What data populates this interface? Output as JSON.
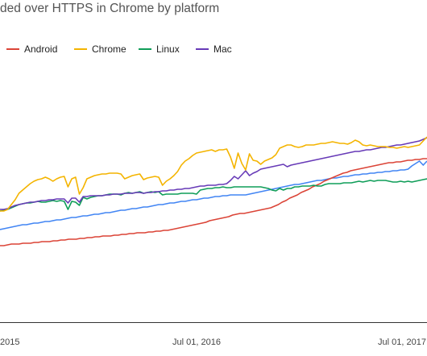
{
  "chart_data": {
    "type": "line",
    "title": "ded over HTTPS in Chrome by platform",
    "xlabel": "",
    "ylabel": "",
    "legend_position": "top-left",
    "grid": false,
    "x_tick_labels": [
      "2015",
      "Jul 01, 2016",
      "Jul 01, 2017"
    ],
    "series": [
      {
        "name": "Android",
        "color": "#db4437",
        "values": [
          305,
          305,
          304,
          303,
          303,
          303,
          302,
          302,
          302,
          301,
          301,
          300,
          300,
          300,
          299,
          299,
          298,
          298,
          297,
          297,
          297,
          296,
          296,
          295,
          295,
          294,
          294,
          293,
          293,
          293,
          292,
          292,
          291,
          291,
          290,
          290,
          289,
          289,
          289,
          288,
          288,
          287,
          287,
          286,
          286,
          285,
          284,
          283,
          282,
          281,
          280,
          279,
          278,
          277,
          276,
          274,
          273,
          272,
          271,
          270,
          269,
          267,
          266,
          265,
          265,
          264,
          263,
          262,
          261,
          260,
          259,
          258,
          256,
          254,
          251,
          249,
          246,
          244,
          242,
          239,
          237,
          235,
          232,
          230,
          228,
          225,
          223,
          221,
          219,
          217,
          215,
          214,
          212,
          211,
          210,
          209,
          208,
          207,
          206,
          205,
          204,
          203,
          202,
          202,
          201,
          201,
          200,
          199,
          199,
          198,
          198,
          197,
          197
        ]
      },
      {
        "name": "Chrome",
        "color": "#f4b400",
        "values": [
          262,
          262,
          260,
          254,
          248,
          240,
          236,
          232,
          228,
          225,
          223,
          222,
          220,
          222,
          225,
          222,
          220,
          219,
          232,
          222,
          220,
          241,
          233,
          222,
          220,
          218,
          217,
          216,
          216,
          215,
          215,
          215,
          216,
          222,
          220,
          218,
          217,
          216,
          223,
          221,
          220,
          219,
          220,
          230,
          225,
          222,
          218,
          213,
          205,
          200,
          197,
          193,
          190,
          189,
          188,
          187,
          186,
          188,
          186,
          186,
          185,
          195,
          209,
          190,
          203,
          211,
          191,
          199,
          200,
          204,
          200,
          198,
          196,
          192,
          184,
          182,
          180,
          180,
          182,
          183,
          182,
          180,
          180,
          180,
          179,
          178,
          178,
          177,
          176,
          177,
          178,
          178,
          179,
          177,
          174,
          176,
          180,
          181,
          180,
          181,
          182,
          182,
          182,
          183,
          183,
          184,
          183,
          182,
          183,
          182,
          181,
          180,
          175,
          170
        ]
      },
      {
        "name": "Linux",
        "color": "#0f9d58",
        "values": [
          262,
          261,
          260,
          258,
          256,
          254,
          253,
          252,
          252,
          251,
          250,
          251,
          251,
          250,
          249,
          250,
          249,
          250,
          260,
          250,
          251,
          255,
          245,
          247,
          245,
          244,
          243,
          243,
          242,
          241,
          241,
          241,
          242,
          240,
          239,
          240,
          239,
          238,
          240,
          239,
          238,
          239,
          238,
          242,
          241,
          241,
          241,
          241,
          240,
          240,
          240,
          240,
          241,
          236,
          235,
          234,
          234,
          233,
          233,
          232,
          233,
          233,
          232,
          232,
          232,
          232,
          232,
          232,
          232,
          232,
          233,
          234,
          236,
          237,
          234,
          236,
          234,
          234,
          232,
          232,
          231,
          231,
          231,
          230,
          231,
          231,
          229,
          228,
          228,
          228,
          228,
          227,
          227,
          227,
          226,
          225,
          226,
          225,
          224,
          225,
          224,
          224,
          224,
          225,
          226,
          226,
          225,
          226,
          225,
          226,
          225,
          224,
          223,
          222
        ]
      },
      {
        "name": "Mac",
        "color": "#673ab7",
        "values": [
          260,
          260,
          259,
          257,
          255,
          254,
          253,
          252,
          251,
          251,
          250,
          249,
          249,
          248,
          248,
          247,
          247,
          247,
          252,
          246,
          246,
          251,
          244,
          244,
          243,
          243,
          243,
          243,
          242,
          242,
          241,
          241,
          241,
          240,
          240,
          240,
          239,
          239,
          240,
          239,
          239,
          238,
          238,
          237,
          237,
          236,
          236,
          235,
          235,
          234,
          234,
          233,
          232,
          231,
          231,
          230,
          230,
          230,
          229,
          229,
          228,
          224,
          219,
          222,
          217,
          212,
          218,
          215,
          213,
          210,
          209,
          208,
          207,
          206,
          205,
          204,
          207,
          205,
          204,
          203,
          202,
          201,
          200,
          199,
          198,
          197,
          196,
          195,
          194,
          193,
          192,
          191,
          190,
          189,
          188,
          188,
          187,
          186,
          186,
          185,
          184,
          183,
          183,
          182,
          181,
          180,
          180,
          179,
          178,
          177,
          176,
          175,
          173,
          171
        ]
      },
      {
        "name": "",
        "color": "#4285f4",
        "values": [
          285,
          284,
          283,
          282,
          281,
          280,
          279,
          279,
          278,
          277,
          277,
          276,
          275,
          275,
          274,
          273,
          273,
          272,
          271,
          270,
          270,
          269,
          268,
          268,
          267,
          266,
          266,
          265,
          264,
          264,
          263,
          262,
          261,
          261,
          260,
          259,
          259,
          258,
          257,
          257,
          256,
          255,
          254,
          254,
          253,
          252,
          252,
          251,
          250,
          250,
          249,
          248,
          248,
          247,
          246,
          246,
          245,
          244,
          244,
          243,
          243,
          242,
          242,
          242,
          242,
          242,
          241,
          240,
          239,
          238,
          237,
          236,
          235,
          234,
          233,
          232,
          231,
          230,
          229,
          229,
          228,
          227,
          226,
          225,
          224,
          224,
          223,
          222,
          221,
          221,
          220,
          219,
          219,
          218,
          217,
          217,
          216,
          216,
          215,
          215,
          214,
          214,
          213,
          213,
          212,
          212,
          211,
          211,
          210,
          206,
          203,
          200,
          205,
          200
        ]
      }
    ]
  }
}
